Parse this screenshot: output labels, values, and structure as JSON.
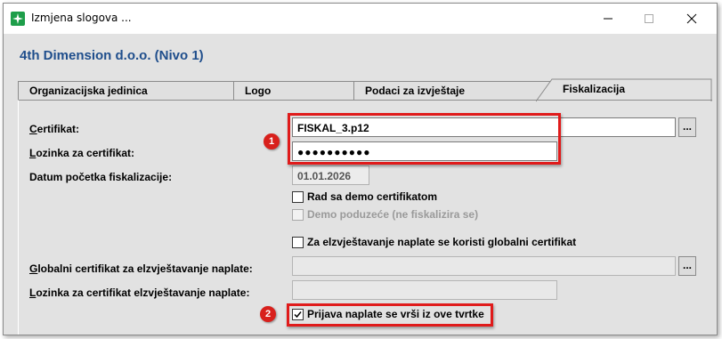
{
  "window": {
    "title": "Izmjena slogova ..."
  },
  "header": {
    "title": "4th Dimension d.o.o. (Nivo 1)"
  },
  "tabs": [
    {
      "label": "Organizacijska jedinica"
    },
    {
      "label": "Logo"
    },
    {
      "label": "Podaci za izvještaje"
    },
    {
      "label": "Fiskalizacija",
      "active": true
    }
  ],
  "form": {
    "certifikat": {
      "label_first": "C",
      "label_rest": "ertifikat:",
      "value": "FISKAL_3.p12",
      "browse": "..."
    },
    "lozinka": {
      "label_first": "L",
      "label_rest": "ozinka za certifikat:",
      "value": "●●●●●●●●●●"
    },
    "datum": {
      "label": "Datum početka fiskalizacije:",
      "value": "01.01.2026"
    },
    "demo_cert": {
      "label": "Rad sa demo certifikatom",
      "checked": false
    },
    "demo_poduzece": {
      "label": "Demo poduzeće (ne fiskalizira se)",
      "checked": false,
      "disabled": true
    },
    "globalni_check": {
      "label": "Za elzvještavanje naplate se koristi globalni certifikat",
      "checked": false
    },
    "globalni_cert": {
      "label_first": "G",
      "label_rest": "lobalni certifikat za elzvještavanje naplate:",
      "value": "",
      "browse": "..."
    },
    "globalni_lozinka": {
      "label_first": "L",
      "label_rest": "ozinka za certifikat elzvještavanje naplate:",
      "value": ""
    },
    "prijava": {
      "label": "Prijava naplate se vrši iz ove tvrtke",
      "checked": true
    }
  },
  "annotations": {
    "marker1": "1",
    "marker2": "2",
    "color": "#e01b1b"
  },
  "colors": {
    "header_title": "#1f4e8c",
    "app_icon": "#1e9e4a",
    "window_bg": "#e2e2e2"
  }
}
